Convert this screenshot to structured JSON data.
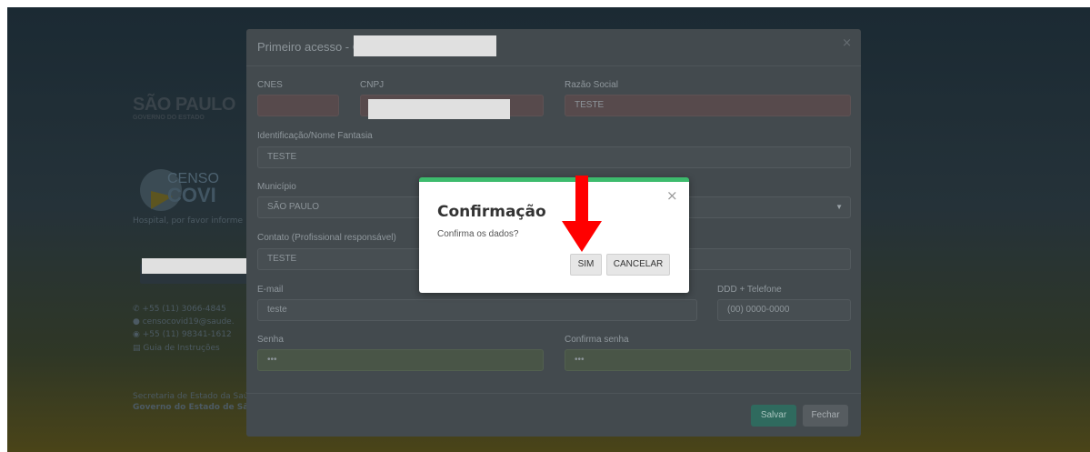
{
  "background": {
    "logo_line1": "SÃO PAULO",
    "logo_line2": "GOVERNO DO ESTADO",
    "censo_line1": "CENSO",
    "censo_line2": "COVI",
    "hint_text": "Hospital, por favor informe",
    "contact_phone": "+55 (11) 3066-4845",
    "contact_email": "censocovid19@saude.",
    "contact_whatsapp": "+55 (11) 98341-1612",
    "guide_link": "Guia de Instruções",
    "footer_line1": "Secretaria de Estado da Saúd",
    "footer_line2": "Governo do Estado de São P"
  },
  "modal": {
    "title": "Primeiro acesso - C",
    "close": "×",
    "labels": {
      "cnes": "CNES",
      "cnpj": "CNPJ",
      "razao_social": "Razão Social",
      "nome_fantasia": "Identificação/Nome Fantasia",
      "municipio": "Município",
      "contato": "Contato (Profissional responsável)",
      "email": "E-mail",
      "telefone": "DDD + Telefone",
      "senha": "Senha",
      "confirma_senha": "Confirma senha"
    },
    "values": {
      "razao_social": "TESTE",
      "nome_fantasia": "TESTE",
      "municipio": "SÃO PAULO",
      "contato": "TESTE",
      "email": "teste",
      "telefone_placeholder": "(00) 0000-0000",
      "senha": "•••",
      "confirma_senha": "•••"
    },
    "buttons": {
      "save": "Salvar",
      "close": "Fechar"
    }
  },
  "confirm_dialog": {
    "title": "Confirmação",
    "message": "Confirma os dados?",
    "close": "×",
    "yes": "SIM",
    "cancel": "CANCELAR",
    "accent": "#3dbb6d"
  },
  "colors": {
    "arrow": "#ff0000",
    "save_button": "#2f6a5e"
  }
}
